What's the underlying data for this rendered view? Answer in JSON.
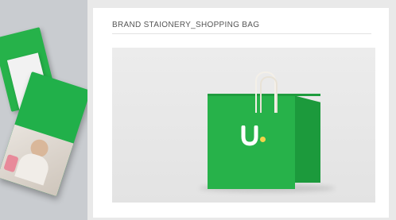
{
  "header": {
    "title": "BRAND STAIONERY_SHOPPING BAG"
  },
  "left_brochure": {
    "subtitle": "",
    "title": ""
  },
  "photo": {
    "paragraphs": [],
    "bag_brand_text": ""
  },
  "colors": {
    "brand_green": "#27b24a",
    "accent_yellow": "#f4d34a"
  }
}
